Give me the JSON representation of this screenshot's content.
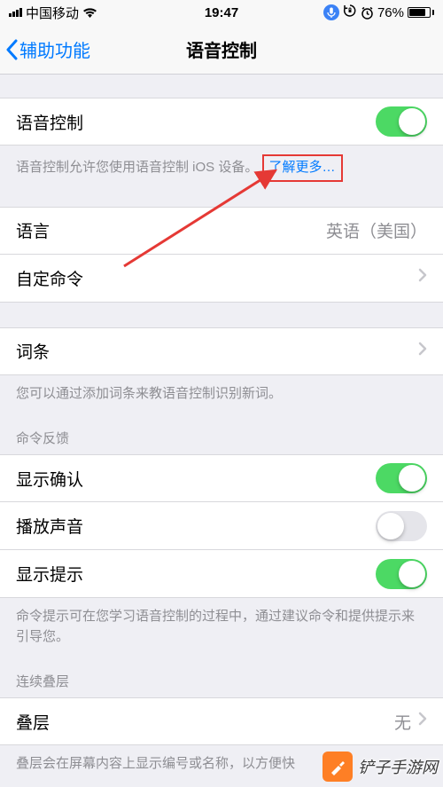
{
  "status": {
    "carrier": "中国移动",
    "time": "19:47",
    "battery_percent": "76%"
  },
  "nav": {
    "back_label": "辅助功能",
    "title": "语音控制"
  },
  "voice_control": {
    "label": "语音控制",
    "enabled": true,
    "footer_prefix": "语音控制允许您使用语音控制 iOS 设备。",
    "learn_more": "了解更多…"
  },
  "language_row": {
    "label": "语言",
    "value": "英语（美国）"
  },
  "custom_commands_row": {
    "label": "自定命令"
  },
  "vocabulary_row": {
    "label": "词条",
    "footer": "您可以通过添加词条来教语音控制识别新词。"
  },
  "feedback_section": {
    "header": "命令反馈",
    "show_confirmation": {
      "label": "显示确认",
      "enabled": true
    },
    "play_sound": {
      "label": "播放声音",
      "enabled": false
    },
    "show_hints": {
      "label": "显示提示",
      "enabled": true
    },
    "footer": "命令提示可在您学习语音控制的过程中，通过建议命令和提供提示来引导您。"
  },
  "overlay_section": {
    "header": "连续叠层",
    "overlay_row": {
      "label": "叠层",
      "value": "无"
    },
    "footer": "叠层会在屏幕内容上显示编号或名称，以方便快"
  },
  "watermark": {
    "text": "铲子手游网"
  }
}
